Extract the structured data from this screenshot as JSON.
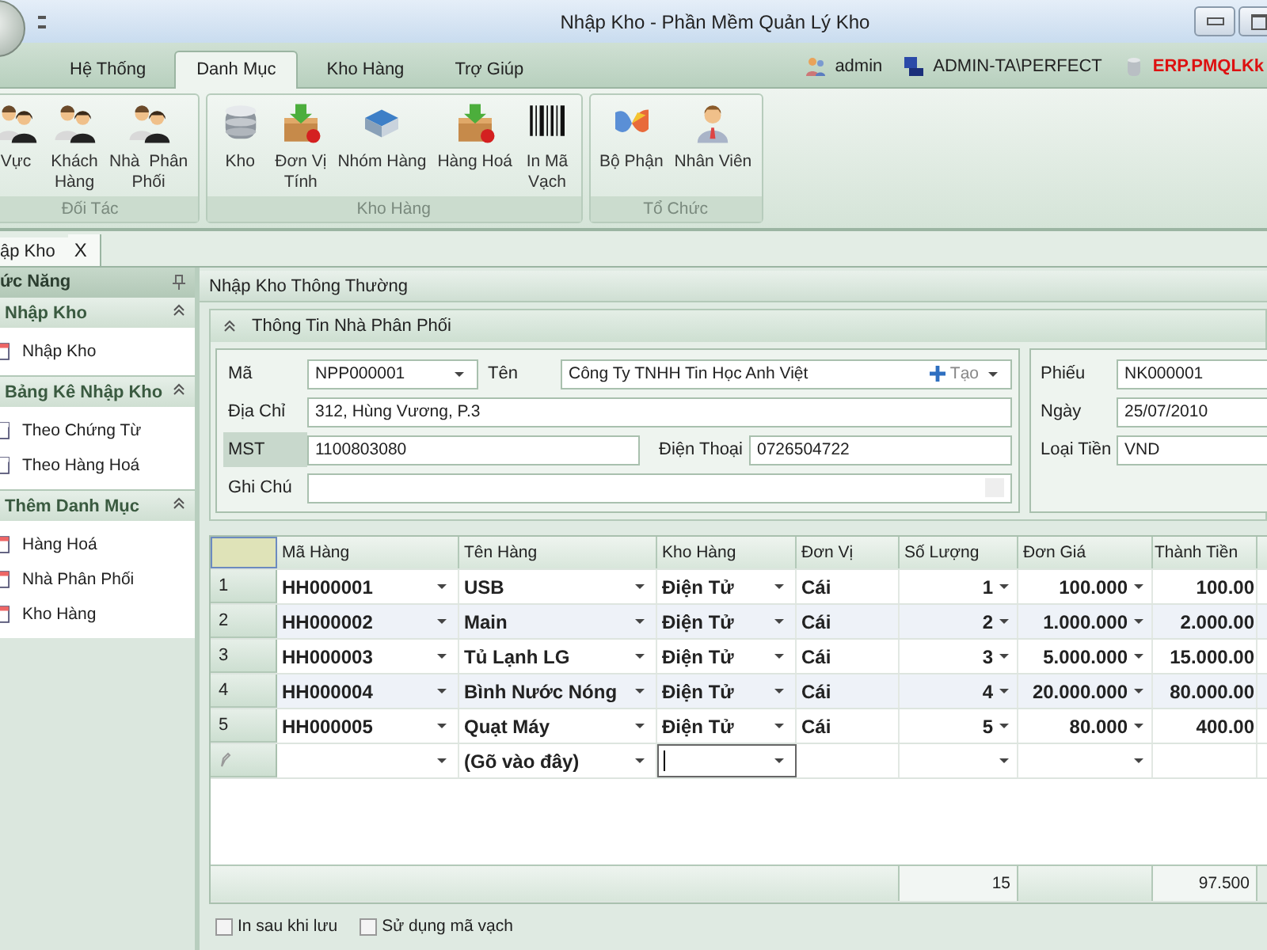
{
  "window": {
    "title": "Nhập Kho - Phần Mềm Quản Lý Kho"
  },
  "ribbon_tabs": [
    {
      "label": "Hệ Thống",
      "selected": false
    },
    {
      "label": "Danh Mục",
      "selected": true
    },
    {
      "label": "Kho Hàng",
      "selected": false
    },
    {
      "label": "Trợ Giúp",
      "selected": false
    }
  ],
  "status_items": [
    {
      "kind": "user",
      "label": "admin"
    },
    {
      "kind": "computer",
      "label": "ADMIN-TA\\PERFECT"
    },
    {
      "kind": "database",
      "label": "ERP.PMQLKk"
    }
  ],
  "ribbon_groups": [
    {
      "title": "Đối Tác",
      "buttons": [
        {
          "label": "Vực"
        },
        {
          "label": "Khách\nHàng"
        },
        {
          "label": "Nhà  Phân\nPhối"
        }
      ]
    },
    {
      "title": "Kho Hàng",
      "buttons": [
        {
          "label": "Kho"
        },
        {
          "label": "Đơn Vị\nTính"
        },
        {
          "label": "Nhóm Hàng"
        },
        {
          "label": "Hàng Hoá"
        },
        {
          "label": "In Mã\nVạch"
        }
      ]
    },
    {
      "title": "Tổ Chức",
      "buttons": [
        {
          "label": "Bộ Phận"
        },
        {
          "label": "Nhân Viên"
        }
      ]
    }
  ],
  "document_tabs": [
    {
      "label": "ập Kho",
      "close": "X",
      "selected": true
    }
  ],
  "side_panel": {
    "title": "ức Năng",
    "groups": [
      {
        "title": "Nhập Kho",
        "expanded": true,
        "items": [
          "Nhập Kho"
        ]
      },
      {
        "title": "Bảng Kê Nhập Kho",
        "expanded": true,
        "items": [
          "Theo Chứng Từ",
          "Theo Hàng Hoá"
        ]
      },
      {
        "title": "Thêm Danh Mục",
        "expanded": true,
        "items": [
          "Hàng Hoá",
          "Nhà Phân Phối",
          "Kho Hàng"
        ]
      }
    ]
  },
  "form": {
    "title": "Nhập Kho Thông Thường",
    "section": "Thông Tin Nhà Phân Phối",
    "supplier": {
      "code_label": "Mã",
      "code": "NPP000001",
      "name_label": "Tên",
      "name": "Công Ty TNHH Tin Học Anh Việt",
      "create_button": "Tạo",
      "address_label": "Địa Chỉ",
      "address": "312, Hùng Vương, P.3",
      "tax_label": "MST",
      "tax": "1100803080",
      "phone_label": "Điện Thoại",
      "phone": "0726504722",
      "note_label": "Ghi Chú"
    },
    "voucher": [
      {
        "label": "Phiếu",
        "value": "NK000001"
      },
      {
        "label": "Ngày",
        "value": "25/07/2010"
      },
      {
        "label": "Loại Tiền",
        "value": "VND"
      }
    ]
  },
  "grid": {
    "columns": [
      {
        "label": "Mã Hàng"
      },
      {
        "label": "Tên Hàng"
      },
      {
        "label": "Kho Hàng"
      },
      {
        "label": "Đơn Vị"
      },
      {
        "label": "Số Lượng"
      },
      {
        "label": "Đơn Giá"
      },
      {
        "label": "Thành Tiền"
      }
    ],
    "rows": [
      {
        "number": "1",
        "cells": [
          "HH000001",
          "USB",
          "Điện Tử",
          "Cái",
          "1",
          "100.000",
          "100.00"
        ]
      },
      {
        "number": "2",
        "cells": [
          "HH000002",
          "Main",
          "Điện Tử",
          "Cái",
          "2",
          "1.000.000",
          "2.000.00"
        ]
      },
      {
        "number": "3",
        "cells": [
          "HH000003",
          "Tủ Lạnh LG",
          "Điện Tử",
          "Cái",
          "3",
          "5.000.000",
          "15.000.00"
        ]
      },
      {
        "number": "4",
        "cells": [
          "HH000004",
          "Bình Nước Nóng",
          "Điện Tử",
          "Cái",
          "4",
          "20.000.000",
          "80.000.00"
        ]
      },
      {
        "number": "5",
        "cells": [
          "HH000005",
          "Quạt Máy",
          "Điện Tử",
          "Cái",
          "5",
          "80.000",
          "400.00"
        ]
      }
    ],
    "new_row_placeholder": "(Gõ vào đây)",
    "totals": {
      "quantity": "15",
      "amount": "97.500"
    }
  },
  "options": [
    {
      "label": "In sau khi lưu",
      "checked": false
    },
    {
      "label": "Sử dụng mã vạch",
      "checked": false
    }
  ]
}
